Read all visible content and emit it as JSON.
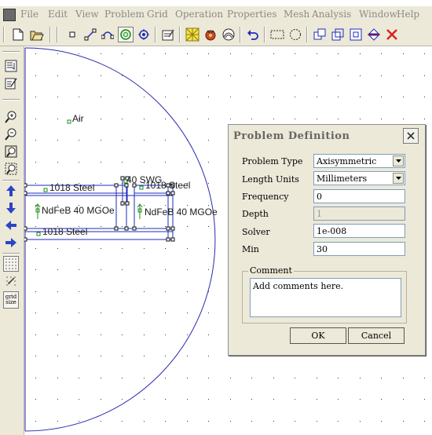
{
  "menu": [
    "File",
    "Edit",
    "View",
    "Problem",
    "Grid",
    "Operation",
    "Properties",
    "Mesh",
    "Analysis",
    "Window",
    "Help"
  ],
  "toolbar": {
    "buttons": [
      "new-icon",
      "open-icon",
      "node-icon",
      "segment-icon",
      "arc-icon",
      "block-label-icon",
      "group-icon",
      "edit-props-icon",
      "mesh-icon",
      "run-icon",
      "view-results-icon",
      "undo-icon",
      "select-rect-icon",
      "select-circle-icon",
      "copy-icon",
      "move-icon",
      "scale-icon",
      "mirror-icon",
      "delete-icon"
    ],
    "active": "block-label-icon"
  },
  "left_toolbar": {
    "buttons": [
      "list-icon",
      "edit-icon",
      "zoom-in-icon",
      "zoom-out-icon",
      "zoom-extents-icon",
      "zoom-window-icon",
      "pan-up-icon",
      "pan-down-icon",
      "pan-left-icon",
      "pan-right-icon",
      "show-grid-icon",
      "snap-grid-icon"
    ],
    "grid_size_label": "grid size"
  },
  "canvas": {
    "labels": {
      "air": "Air",
      "steel_top": "1018 Steel",
      "steel_mid": "1018 Steel",
      "steel_bottom": "1018 Steel",
      "ndfeb_left": "NdFeB 40 MGOe",
      "ndfeb_right": "NdFeB 40 MGOe",
      "swg": "40 SWG"
    }
  },
  "dialog": {
    "title": "Problem Definition",
    "fields": {
      "problem_type": {
        "label": "Problem Type",
        "value": "Axisymmetric"
      },
      "length_units": {
        "label": "Length Units",
        "value": "Millimeters"
      },
      "frequency": {
        "label": "Frequency",
        "value": "0"
      },
      "depth": {
        "label": "Depth",
        "value": "1"
      },
      "solver": {
        "label": "Solver",
        "value": "1e-008"
      },
      "min": {
        "label": "Min",
        "value": "30"
      }
    },
    "comment": {
      "legend": "Comment",
      "value": "Add comments here."
    },
    "ok_label": "OK",
    "cancel_label": "Cancel"
  },
  "colors": {
    "outline": "#2b2bb0",
    "geometry": "#1d2bbd",
    "node": "#1b8b1b",
    "chrome": "#ece9d8",
    "title_text": "#666666",
    "close_x": "#c0392b"
  }
}
